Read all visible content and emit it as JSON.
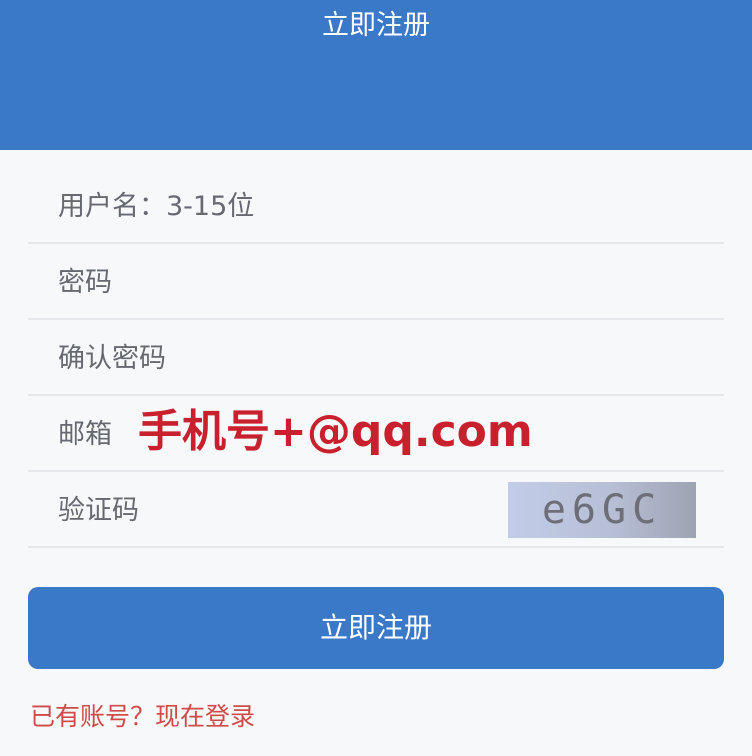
{
  "header": {
    "title": "立即注册"
  },
  "form": {
    "username": {
      "placeholder": "用户名：3-15位"
    },
    "password": {
      "placeholder": "密码"
    },
    "confirm_password": {
      "placeholder": "确认密码"
    },
    "email": {
      "placeholder": "邮箱",
      "note": "手机号+@qq.com"
    },
    "captcha": {
      "placeholder": "验证码",
      "image_text": "e6GC"
    }
  },
  "submit_label": "立即注册",
  "login_link": "已有账号？现在登录",
  "colors": {
    "primary": "#3a78c8",
    "note": "#c8202c",
    "link": "#d14a4a"
  }
}
